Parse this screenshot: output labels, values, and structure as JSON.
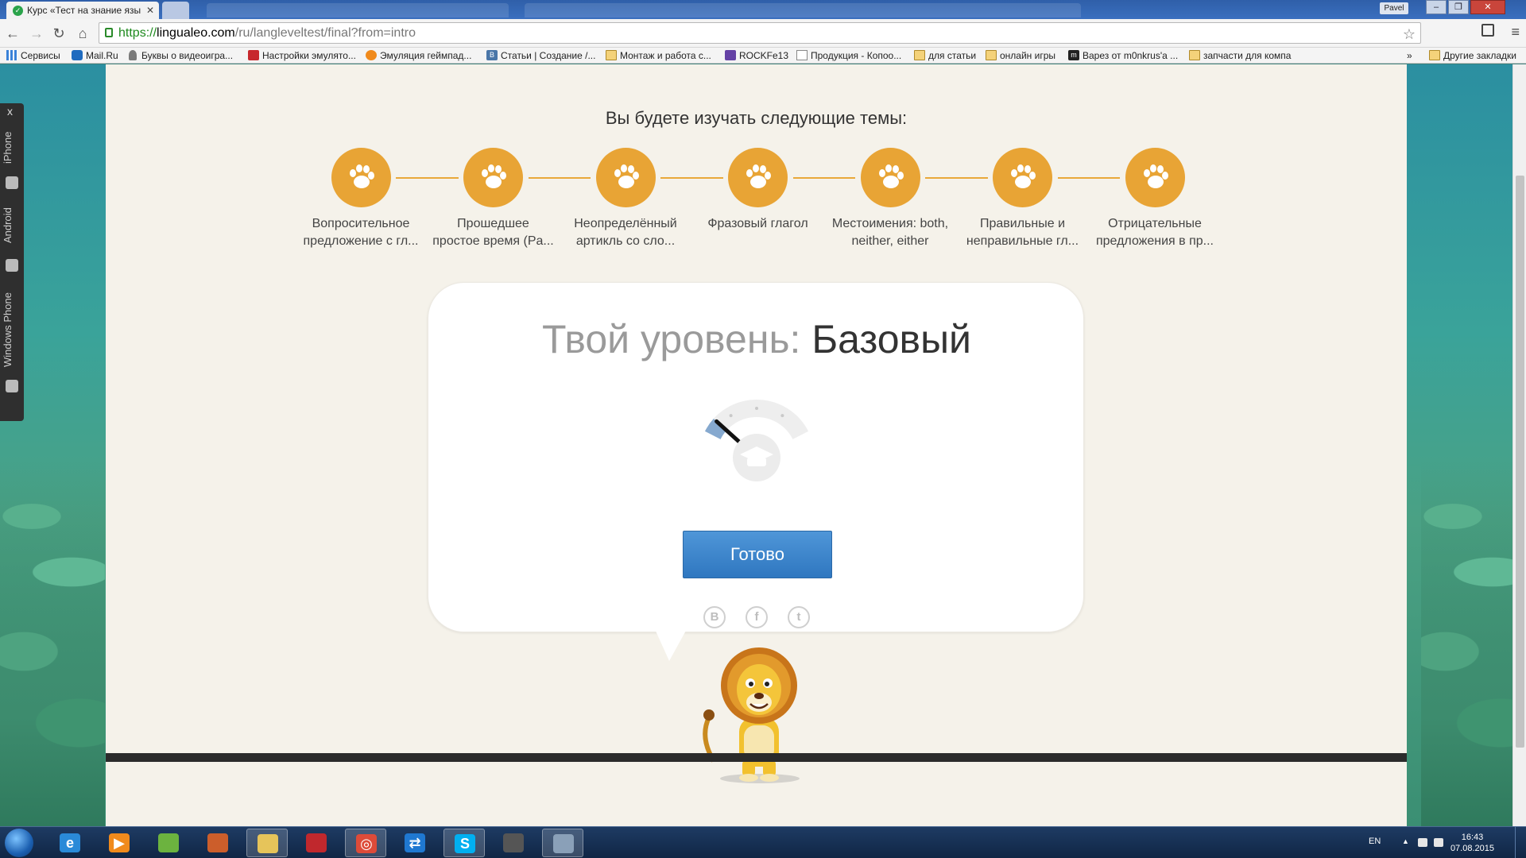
{
  "browser": {
    "active_tab_title": "Курс «Тест на знание язы",
    "address": {
      "scheme": "https://",
      "host": "lingualeo.com",
      "path": "/ru/langleveltest/final?from=intro"
    },
    "user": "Pavel",
    "bookmarks": [
      {
        "label": "Сервисы",
        "icon": "apps-grid-icon"
      },
      {
        "label": "Mail.Ru",
        "icon": "mailru-icon"
      },
      {
        "label": "Буквы о видеоигра...",
        "icon": "person-icon"
      },
      {
        "label": "Настройки эмулято...",
        "icon": "red-page-icon"
      },
      {
        "label": "Эмуляция геймпад...",
        "icon": "orange-site-icon"
      },
      {
        "label": "Статьи | Создание /...",
        "icon": "vk-icon"
      },
      {
        "label": "Монтаж и работа с...",
        "icon": "folder-icon"
      },
      {
        "label": "ROCKFe13",
        "icon": "twitch-icon"
      },
      {
        "label": "Продукция - Копоо...",
        "icon": "page-icon"
      },
      {
        "label": "для статьи",
        "icon": "folder-icon"
      },
      {
        "label": "онлайн игры",
        "icon": "folder-icon"
      },
      {
        "label": "Варез от m0nkrus'a ...",
        "icon": "m-site-icon"
      },
      {
        "label": "запчасти для компа",
        "icon": "folder-icon"
      }
    ],
    "bookmarks_overflow": "»",
    "other_bookmarks": "Другие закладки"
  },
  "side_widget": {
    "close": "x",
    "items": [
      "iPhone",
      "Android",
      "Windows Phone"
    ]
  },
  "page": {
    "topics_heading": "Вы будете изучать следующие темы:",
    "topics": [
      {
        "line1": "Вопросительное",
        "line2": "предложение с гл..."
      },
      {
        "line1": "Прошедшее",
        "line2": "простое время (Pa..."
      },
      {
        "line1": "Неопределённый",
        "line2": "артикль со сло..."
      },
      {
        "line1": "Фразовый глагол",
        "line2": ""
      },
      {
        "line1": "Местоимения: both,",
        "line2": "neither, either"
      },
      {
        "line1": "Правильные и",
        "line2": "неправильные гл..."
      },
      {
        "line1": "Отрицательные",
        "line2": "предложения в пр..."
      }
    ],
    "level_label": "Твой уровень:",
    "level_value": "Базовый",
    "level_fraction": 0.12,
    "done_button": "Готово",
    "share": {
      "vk": "B",
      "facebook": "f",
      "twitter": "t"
    },
    "accent_color": "#e8a435",
    "button_color": "#3f86cc"
  },
  "taskbar": {
    "apps": [
      "start",
      "internet-explorer",
      "media-player",
      "nvidia",
      "paint",
      "explorer",
      "keyboard-app",
      "chrome",
      "teamviewer",
      "skype",
      "game",
      "file-manager"
    ],
    "lang": "EN",
    "time": "16:43",
    "date": "07.08.2015"
  }
}
